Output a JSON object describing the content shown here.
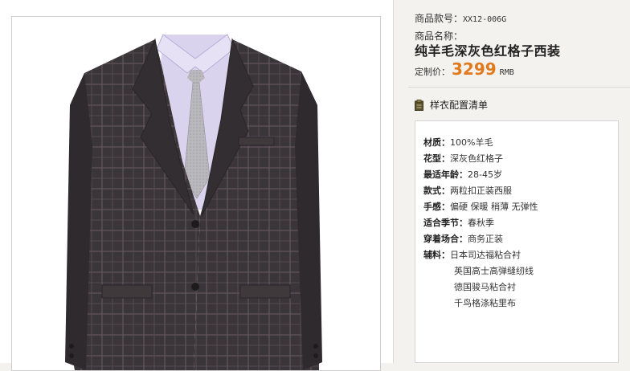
{
  "product": {
    "code_label": "商品款号：",
    "code_value": "XX12-006G",
    "name_label": "商品名称：",
    "name": "纯羊毛深灰色红格子西装",
    "price_label": "定制价：",
    "price_value": "3299",
    "price_unit": "RMB"
  },
  "section": {
    "title": "样衣配置清单",
    "icon": "clipboard-icon"
  },
  "specs": [
    {
      "label": "材质：",
      "value": "100%羊毛"
    },
    {
      "label": "花型：",
      "value": "深灰色红格子"
    },
    {
      "label": "最适年龄：",
      "value": "28-45岁"
    },
    {
      "label": "款式：",
      "value": "两粒扣正装西服"
    },
    {
      "label": "手感：",
      "value": "偏硬 保暖 稍薄 无弹性"
    },
    {
      "label": "适合季节：",
      "value": "春秋季"
    },
    {
      "label": "穿着场合：",
      "value": "商务正装"
    },
    {
      "label": "辅料：",
      "value": "日本司达福粘合衬"
    }
  ],
  "extra_accessories": [
    "英国高士高弹缝纫线",
    "德国骏马粘合衬",
    "千鸟格涤粘里布"
  ],
  "colors": {
    "price": "#e07a1c",
    "suit": "#3a3538",
    "shirt": "#d9d3ee",
    "tie": "#b8b8bc"
  }
}
